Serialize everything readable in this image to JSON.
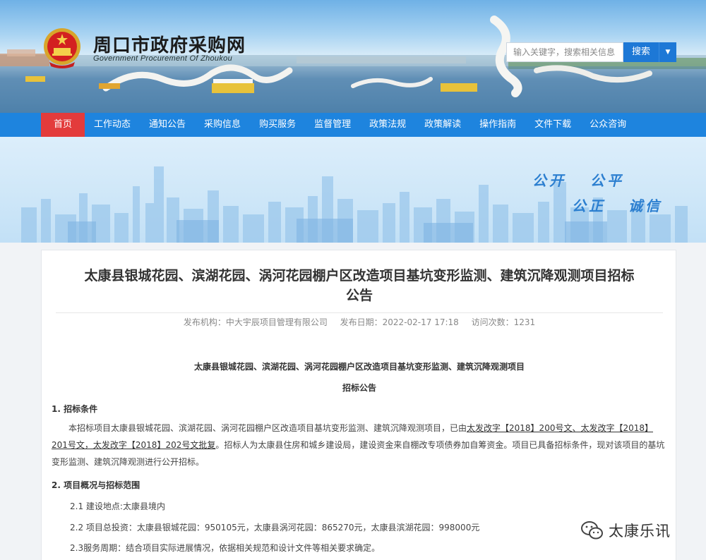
{
  "header": {
    "site_title": "周口市政府采购网",
    "site_subtitle": "Government Procurement Of Zhoukou",
    "search_placeholder": "输入关键字，搜索相关信息",
    "search_button": "搜索"
  },
  "nav": {
    "items": [
      {
        "label": "首页",
        "active": true
      },
      {
        "label": "工作动态"
      },
      {
        "label": "通知公告"
      },
      {
        "label": "采购信息"
      },
      {
        "label": "购买服务"
      },
      {
        "label": "监督管理"
      },
      {
        "label": "政策法规"
      },
      {
        "label": "政策解读"
      },
      {
        "label": "操作指南"
      },
      {
        "label": "文件下载"
      },
      {
        "label": "公众咨询"
      }
    ]
  },
  "banner": {
    "slogan_1": "公开",
    "slogan_2": "公平",
    "slogan_3": "公正",
    "slogan_4": "诚信"
  },
  "article": {
    "title_line1": "太康县银城花园、滨湖花园、涡河花园棚户区改造项目基坑变形监测、建筑沉降观测项目招标",
    "title_line2": "公告",
    "publisher": "发布机构：中大宇辰项目管理有限公司",
    "publish_date": "发布日期：2022-02-17 17:18",
    "visits": "访问次数：1231",
    "doc_title": "太康县银城花园、滨湖花园、涡河花园棚户区改造项目基坑变形监测、建筑沉降观测项目",
    "doc_subtitle": "招标公告",
    "section1": "1. 招标条件",
    "para1_a": "本招标项目太康县银城花园、滨湖花园、涡河花园棚户区改造项目基坑变形监测、建筑沉降观测项目，已由",
    "para1_link": "太发改字【2018】200号文、太发改字【2018】201号文，太发改字【2018】202号文批复",
    "para1_b": "。招标人为太康县住房和城乡建设局，建设资金来自棚改专项债券加自筹资金。项目已具备招标条件，现对该项目的基坑变形监测、建筑沉降观测进行公开招标。",
    "section2": "2. 项目概况与招标范围",
    "item_2_1": "2.1  建设地点:太康县境内",
    "item_2_2": "2.2  项目总投资：太康县银城花园：950105元，太康县涡河花园：865270元，太康县滨湖花园：998000元",
    "item_2_3": "2.3服务周期：结合项目实际进展情况，依据相关规范和设计文件等相关要求确定。"
  },
  "watermark": {
    "text": "太康乐讯"
  }
}
